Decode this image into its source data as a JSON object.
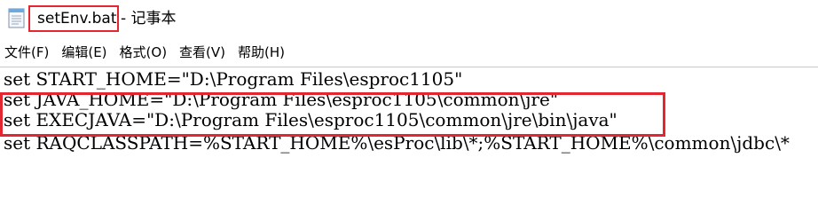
{
  "window": {
    "file_name": "setEnv.bat",
    "app_suffix": "- 记事本",
    "app_icon": "notepad-icon"
  },
  "menu": {
    "items": [
      {
        "label": "文件(F)"
      },
      {
        "label": "编辑(E)"
      },
      {
        "label": "格式(O)"
      },
      {
        "label": "查看(V)"
      },
      {
        "label": "帮助(H)"
      }
    ]
  },
  "editor": {
    "lines": [
      "set START_HOME=\"D:\\Program Files\\esproc1105\"",
      "set JAVA_HOME=\"D:\\Program Files\\esproc1105\\common\\jre\"",
      "set EXECJAVA=\"D:\\Program Files\\esproc1105\\common\\jre\\bin\\java\"",
      "set RAQCLASSPATH=%START_HOME%\\esProc\\lib\\*;%START_HOME%\\common\\jdbc\\*"
    ]
  },
  "annotations": {
    "highlight_color": "#e3262f"
  }
}
